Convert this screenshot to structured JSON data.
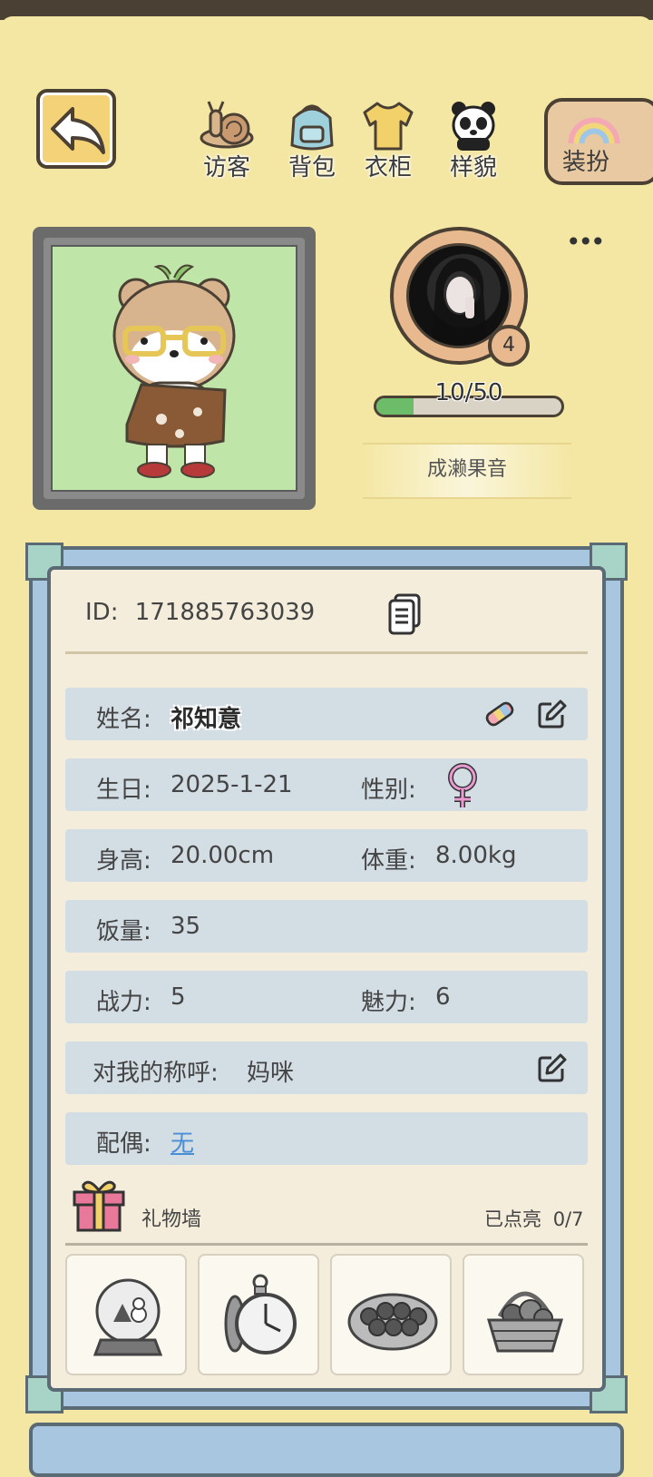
{
  "nav": {
    "visitor_label": "访客",
    "bag_label": "背包",
    "wardrobe_label": "衣柜",
    "appearance_label": "样貌",
    "dress_up_label": "装扮"
  },
  "profile": {
    "level": "4",
    "exp_text": "10/50",
    "exp_fraction": 0.2,
    "nickname": "成濑果音",
    "more": "•••"
  },
  "info": {
    "id_label": "ID:",
    "id_value": "171885763039",
    "name_label": "姓名:",
    "name_value": "祁知意",
    "birthday_label": "生日:",
    "birthday_value": "2025-1-21",
    "gender_label": "性别:",
    "gender_icon": "female-symbol-icon",
    "height_label": "身高:",
    "height_value": "20.00cm",
    "weight_label": "体重:",
    "weight_value": "8.00kg",
    "food_label": "饭量:",
    "food_value": "35",
    "power_label": "战力:",
    "power_value": "5",
    "charm_label": "魅力:",
    "charm_value": "6",
    "call_label": "对我的称呼:",
    "call_value": "妈咪",
    "spouse_label": "配偶:",
    "spouse_value": "无"
  },
  "gift_wall": {
    "title": "礼物墙",
    "lit_label": "已点亮",
    "lit_count": "0/7",
    "items": [
      "snow-globe-icon",
      "pocket-watch-icon",
      "rose-bouquet-icon",
      "fruit-basket-icon"
    ]
  },
  "colors": {
    "background": "#f4e7a4",
    "panel_frame": "#a9c6e0",
    "row_bg": "#d2dde4",
    "link": "#4a8fd6",
    "exp_fill": "#6cbc6a"
  }
}
